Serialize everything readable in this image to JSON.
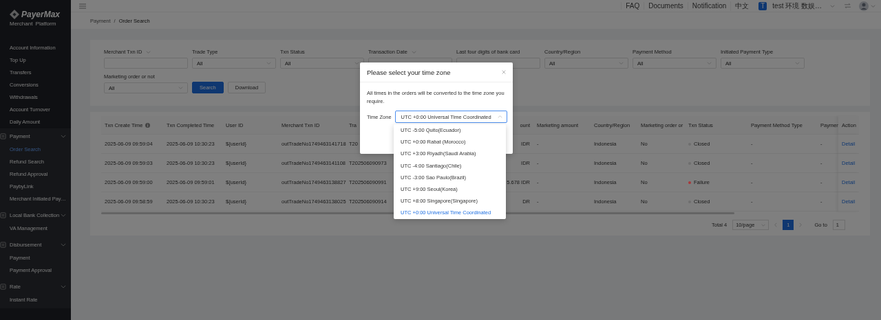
{
  "header": {
    "items": [
      "FAQ",
      "Documents",
      "Notification",
      "中文"
    ],
    "account_initial": "T",
    "account_name": "test 环境 数娱…"
  },
  "sidebar": {
    "brand": "PayerMax",
    "subtitle": "Merchant  Platform",
    "items": [
      {
        "label": "Account Information",
        "kind": "link"
      },
      {
        "label": "Top Up",
        "kind": "link"
      },
      {
        "label": "Transfers",
        "kind": "link"
      },
      {
        "label": "Conversions",
        "kind": "link"
      },
      {
        "label": "Withdrawals",
        "kind": "link"
      },
      {
        "label": "Account Turnover",
        "kind": "link"
      },
      {
        "label": "Daily Amount",
        "kind": "link"
      },
      {
        "label": "Payment",
        "kind": "group",
        "expanded": true,
        "children": [
          {
            "label": "Order Search",
            "selected": true
          },
          {
            "label": "Refund Search",
            "selected": false
          },
          {
            "label": "Refund Approval",
            "selected": false
          },
          {
            "label": "PaybyLink",
            "selected": false
          },
          {
            "label": "Merchant Initiated Pay…",
            "selected": false
          }
        ]
      },
      {
        "label": "Local Bank Collection",
        "kind": "group",
        "expanded": true,
        "children": [
          {
            "label": "VA Management",
            "selected": false
          }
        ]
      },
      {
        "label": "Disbursement",
        "kind": "group",
        "expanded": true,
        "children": [
          {
            "label": "Payment",
            "selected": false
          },
          {
            "label": "Payment Approval",
            "selected": false
          }
        ]
      },
      {
        "label": "Rate",
        "kind": "group",
        "expanded": true,
        "children": [
          {
            "label": "Instant Rate",
            "selected": false
          }
        ]
      }
    ]
  },
  "breadcrumb": {
    "items": [
      "Payment",
      "Order Search"
    ],
    "separator": "/"
  },
  "filters": [
    {
      "label": "Merchant Txn ID",
      "kind": "input",
      "switchable": true
    },
    {
      "label": "Trade Type",
      "kind": "select",
      "value": "All"
    },
    {
      "label": "Txn Status",
      "kind": "select",
      "value": "All"
    },
    {
      "label": "Transaction Date",
      "kind": "date",
      "switchable": true
    },
    {
      "label": "Last four digits of bank card",
      "kind": "input"
    },
    {
      "label": "Country/Region",
      "kind": "select",
      "value": "All"
    },
    {
      "label": "Payment Method",
      "kind": "select",
      "value": "All"
    },
    {
      "label": "Initiated Payment Type",
      "kind": "select",
      "value": "All"
    },
    {
      "label": "Marketing order or not",
      "kind": "select",
      "value": "All"
    }
  ],
  "buttons": [
    {
      "label": "Search",
      "kind": "primary"
    },
    {
      "label": "Download",
      "kind": "default"
    }
  ],
  "table": {
    "columns": [
      {
        "label": "Txn Create Time",
        "kind": "text",
        "info": true
      },
      {
        "label": "Txn Completed Time",
        "kind": "text"
      },
      {
        "label": "User ID",
        "kind": "text"
      },
      {
        "label": "Merchant Txn ID",
        "kind": "text"
      },
      {
        "label": "Tra",
        "kind": "text"
      },
      {
        "label": "ount",
        "kind": "amount"
      },
      {
        "label": "Marketing amount",
        "kind": "text"
      },
      {
        "label": "Country/Region",
        "kind": "text"
      },
      {
        "label": "Marketing order or",
        "kind": "text"
      },
      {
        "label": "Txn Status",
        "kind": "status"
      },
      {
        "label": "Payment Method Type",
        "kind": "text"
      },
      {
        "label": "Paymen",
        "kind": "text"
      },
      {
        "label": "Action",
        "kind": "link"
      }
    ],
    "rows": [
      {
        "color": "#6e6e6e",
        "cells": [
          "2025-06-09 09:59:04",
          "2025-06-09 10:30:23",
          "${userId}",
          "outTradeNo1749463141718",
          "T20",
          "IDR",
          "-",
          "Indonesia",
          "No",
          "Closed",
          "-",
          "-",
          "Detail"
        ]
      },
      {
        "color": "#6e6e6e",
        "cells": [
          "2025-06-09 09:59:03",
          "2025-06-09 10:30:23",
          "${userId}",
          "outTradeNo1749463141108",
          "T202506090973",
          "IDR",
          "-",
          "Indonesia",
          "No",
          "Closed",
          "-",
          "-",
          "Detail"
        ]
      },
      {
        "color": "#a8393b",
        "cells": [
          "2025-06-09 09:59:00",
          "2025-06-09 09:59:01",
          "${userId}",
          "outTradeNo1749463138827",
          "T202506090991",
          "5.678 IDR",
          "-",
          "Indonesia",
          "No",
          "Failure",
          "-",
          "-",
          "Detail"
        ]
      },
      {
        "color": "#6e6e6e",
        "cells": [
          "2025-06-09 09:58:59",
          "2025-06-09 10:30:23",
          "${userId}",
          "outTradeNo1749463138025",
          "T202506090914",
          "DR",
          "-",
          "Indonesia",
          "No",
          "Closed",
          "-",
          "-",
          "Detail"
        ]
      }
    ]
  },
  "pagination": {
    "total": "Total 4",
    "page_size": "10/page",
    "pages": [
      {
        "label": "1",
        "selected": true
      }
    ],
    "goto_label": "Go to",
    "goto_value": "1"
  },
  "modal": {
    "title": "Please select your time zone",
    "message": "All times in the orders will be converted to the time zone you require.",
    "field_label": "Time Zone",
    "value": "UTC +0:00 Universal Time Coordinated",
    "expanded": true,
    "options": [
      {
        "label": "UTC -5:00 Quito(Ecuador)",
        "selected": false
      },
      {
        "label": "UTC +0:00 Rabat (Morocco)",
        "selected": false
      },
      {
        "label": "UTC +3:00 Riyadh(Saudi Arabia)",
        "selected": false
      },
      {
        "label": "UTC -4:00 Santiago(Chile)",
        "selected": false
      },
      {
        "label": "UTC -3:00 Sao Paulo(Brazil)",
        "selected": false
      },
      {
        "label": "UTC +9:00 Seoul(Korea)",
        "selected": false
      },
      {
        "label": "UTC +8:00 Singapore(Singapore)",
        "selected": false
      },
      {
        "label": "UTC +0:00 Universal Time Coordinated",
        "selected": true
      }
    ]
  }
}
